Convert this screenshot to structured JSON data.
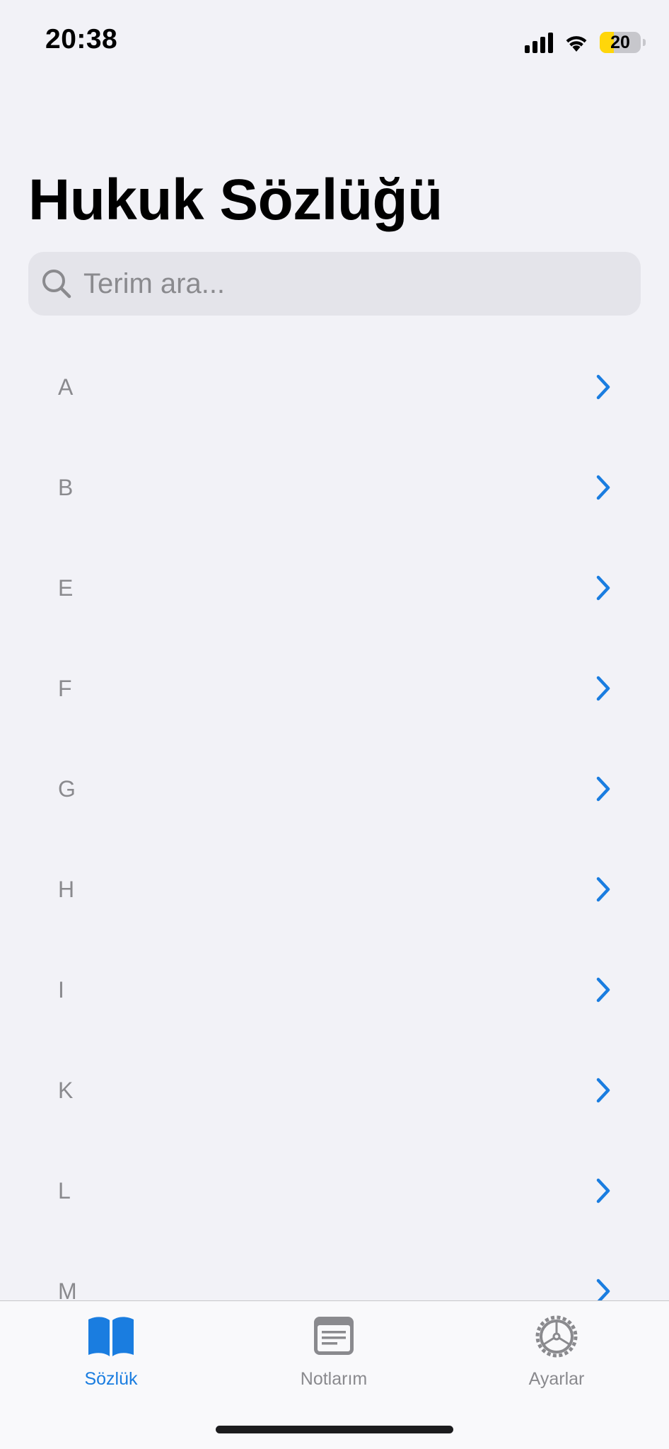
{
  "status_bar": {
    "time": "20:38",
    "battery": "20",
    "battery_level": 0.2,
    "icons": [
      "signal-icon",
      "wifi-icon",
      "battery-icon"
    ]
  },
  "title": "Hukuk Sözlüğü",
  "search": {
    "placeholder": "Terim ara...",
    "value": ""
  },
  "list": {
    "items": [
      {
        "label": "A"
      },
      {
        "label": "B"
      },
      {
        "label": "E"
      },
      {
        "label": "F"
      },
      {
        "label": "G"
      },
      {
        "label": "H"
      },
      {
        "label": "I"
      },
      {
        "label": "K"
      },
      {
        "label": "L"
      },
      {
        "label": "M"
      }
    ]
  },
  "tab_bar": {
    "tabs": [
      {
        "label": "Sözlük",
        "icon": "book-icon",
        "active": true
      },
      {
        "label": "Notlarım",
        "icon": "notes-icon",
        "active": false
      },
      {
        "label": "Ayarlar",
        "icon": "gear-icon",
        "active": false
      }
    ]
  },
  "colors": {
    "accent": "#1a7de0",
    "background": "#f2f2f7",
    "inactive": "#8a8a8e",
    "battery_low": "#ffd60a"
  }
}
